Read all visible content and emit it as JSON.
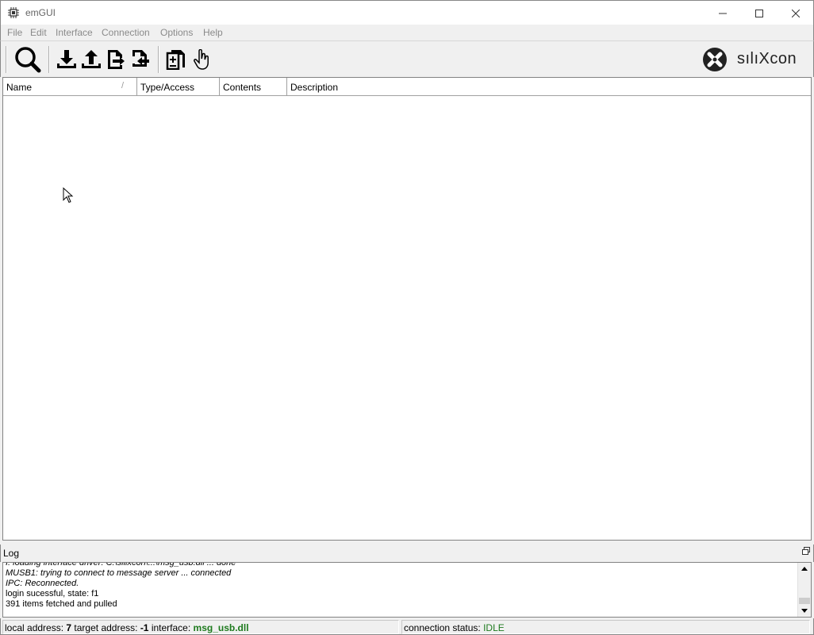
{
  "window": {
    "title": "emGUI",
    "controls": {
      "minimize": "minimize-icon",
      "maximize": "maximize-icon",
      "close": "close-icon"
    }
  },
  "menu": [
    "File",
    "Edit",
    "Interface",
    "Connection",
    "Options",
    "Help"
  ],
  "toolbar": {
    "buttons": [
      "search-icon",
      "download-icon",
      "upload-icon",
      "file-export-icon",
      "file-import-icon",
      "document-add-icon",
      "hand-pointer-icon"
    ],
    "logo_text": "sılıXcon"
  },
  "tree": {
    "columns": [
      "Name",
      "Type/Access",
      "Contents",
      "Description"
    ],
    "sort_indicator": "/"
  },
  "log": {
    "title": "Log",
    "lines": [
      "I: loading interface driver: C:\\silixcon\\...\\msg_usb.dll ... done",
      "MUSB1: trying to connect to message server ... connected",
      "IPC: Reconnected.",
      "login sucessful, state: f1",
      "391 items fetched and pulled"
    ]
  },
  "status": {
    "local_label": "local address:",
    "local_value": "7",
    "target_label": "target address:",
    "target_value": "-1",
    "iface_label": "interface:",
    "iface_value": "msg_usb.dll",
    "conn_label": "connection status:",
    "conn_value": "IDLE"
  },
  "colors": {
    "accent_green": "#1e7a1e",
    "disabled_menu": "#8a8a8a"
  }
}
